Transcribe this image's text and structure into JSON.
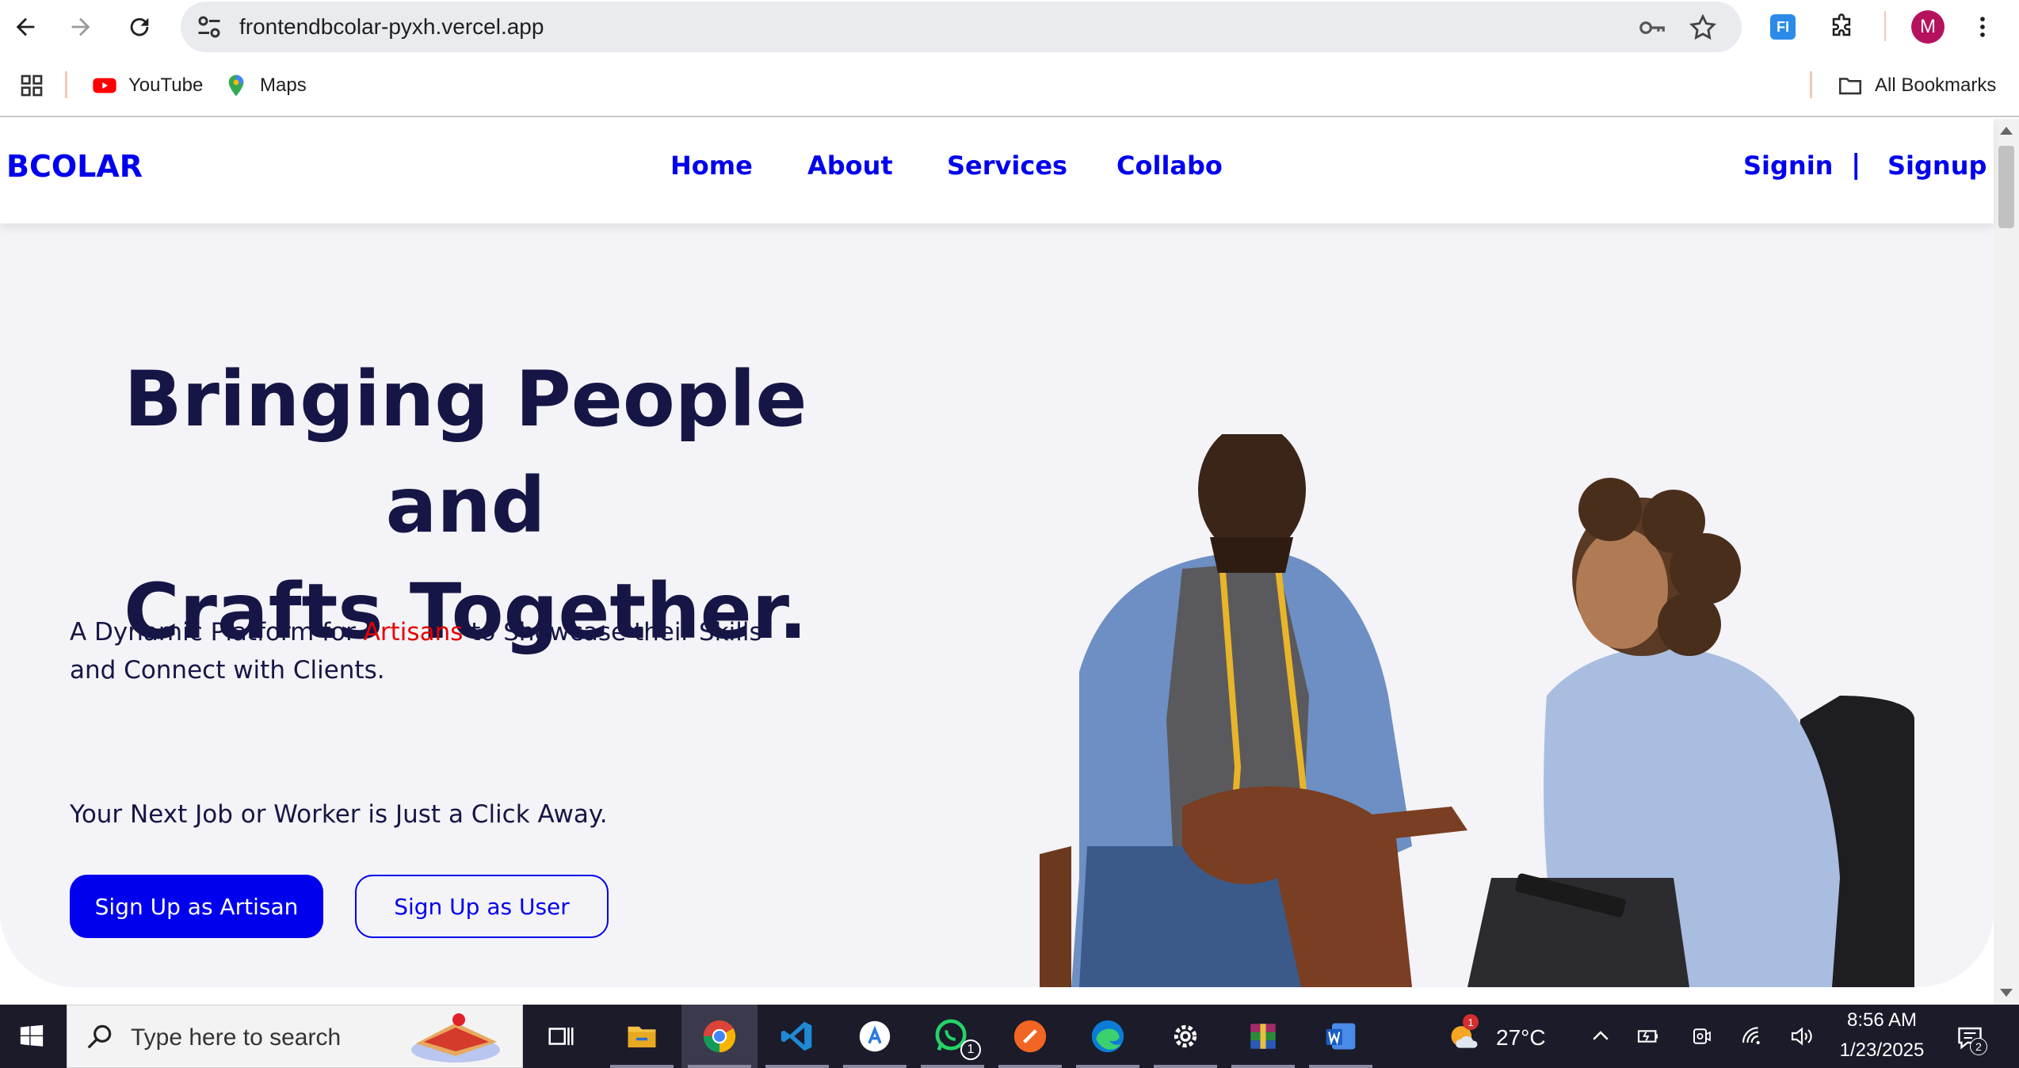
{
  "browser": {
    "url": "frontendbcolar-pyxh.vercel.app",
    "profile_initial": "M",
    "extension_label": "FI",
    "bookmarks": [
      {
        "label": "YouTube",
        "icon": "youtube-icon"
      },
      {
        "label": "Maps",
        "icon": "maps-pin-icon"
      }
    ],
    "all_bookmarks_label": "All Bookmarks"
  },
  "site": {
    "brand": "BCOLAR",
    "nav": [
      {
        "label": "Home"
      },
      {
        "label": "About"
      },
      {
        "label": "Services"
      },
      {
        "label": "Collabo"
      }
    ],
    "auth": {
      "signin": "Signin",
      "separator": "|",
      "signup": "Signup"
    },
    "hero": {
      "title_line1": "Bringing People and",
      "title_line2": "Crafts Together.",
      "desc_before": "A Dynamic Platform for ",
      "desc_highlight": "Artisans",
      "desc_after": " to Showcase their Skills and Connect with Clients.",
      "tagline": "Your Next Job or Worker is Just a Click Away.",
      "cta_primary": "Sign Up as Artisan",
      "cta_secondary": "Sign Up as User",
      "image_description": "tailor-and-client-photo"
    },
    "colors": {
      "brand_blue": "#0000ee",
      "heading_navy": "#161646",
      "highlight_red": "#e60000",
      "hero_bg": "#f4f3f7"
    }
  },
  "taskbar": {
    "search_placeholder": "Type here to search",
    "apps": [
      "task-view",
      "file-explorer",
      "chrome",
      "vscode",
      "app-store",
      "whatsapp",
      "brush-app",
      "edge",
      "settings",
      "winrar",
      "word"
    ],
    "whatsapp_badge": "1",
    "weather": {
      "temperature": "27°C",
      "badge": "1"
    },
    "clock": {
      "time": "8:56 AM",
      "date": "1/23/2025"
    },
    "notifications_count": "2"
  }
}
